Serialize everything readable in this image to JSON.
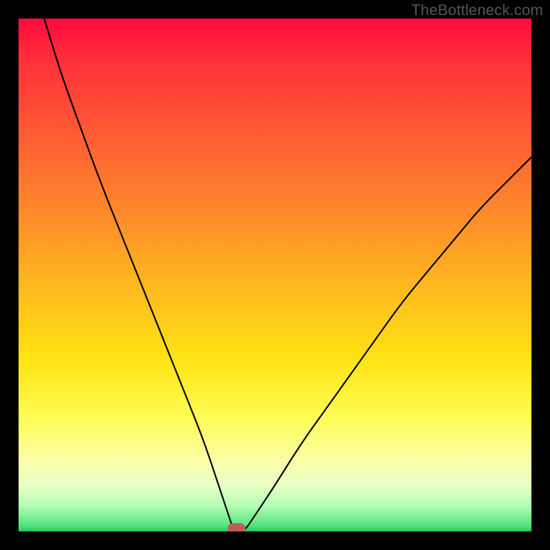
{
  "watermark": "TheBottleneck.com",
  "colors": {
    "frame": "#000000",
    "curve": "#000000",
    "marker": "#c35a5a",
    "gradient_top": "#ff0a3c",
    "gradient_bottom": "#1fc55d"
  },
  "chart_data": {
    "type": "line",
    "title": "",
    "xlabel": "",
    "ylabel": "",
    "xlim": [
      0,
      100
    ],
    "ylim": [
      0,
      100
    ],
    "grid": false,
    "legend": false,
    "series": [
      {
        "name": "bottleneck-curve",
        "x_min_at": 42,
        "x": [
          5,
          8,
          12,
          16,
          20,
          24,
          28,
          32,
          36,
          39,
          41,
          42,
          44,
          46,
          50,
          55,
          60,
          65,
          70,
          75,
          80,
          85,
          90,
          95,
          100
        ],
        "y": [
          100,
          90,
          79,
          68,
          58,
          48,
          38,
          28,
          18,
          9,
          3,
          0,
          0,
          3,
          9,
          17,
          24,
          31,
          38,
          45,
          51,
          57,
          63,
          68,
          73
        ]
      }
    ],
    "annotations": [
      {
        "type": "marker",
        "shape": "pill",
        "x": 42.5,
        "y": 0.5,
        "color": "#c35a5a"
      }
    ],
    "background_gradient": {
      "direction": "top-to-bottom",
      "stops": [
        {
          "pos": 0.0,
          "color": "#ff0a3c"
        },
        {
          "pos": 0.08,
          "color": "#ff2f3a"
        },
        {
          "pos": 0.22,
          "color": "#ff5a34"
        },
        {
          "pos": 0.38,
          "color": "#ff8a2a"
        },
        {
          "pos": 0.52,
          "color": "#ffb81f"
        },
        {
          "pos": 0.66,
          "color": "#ffe212"
        },
        {
          "pos": 0.78,
          "color": "#fffd55"
        },
        {
          "pos": 0.86,
          "color": "#fbffa5"
        },
        {
          "pos": 0.91,
          "color": "#e8ffc6"
        },
        {
          "pos": 0.95,
          "color": "#b3ffb3"
        },
        {
          "pos": 0.99,
          "color": "#4fe27a"
        },
        {
          "pos": 1.0,
          "color": "#1fc55d"
        }
      ]
    }
  }
}
